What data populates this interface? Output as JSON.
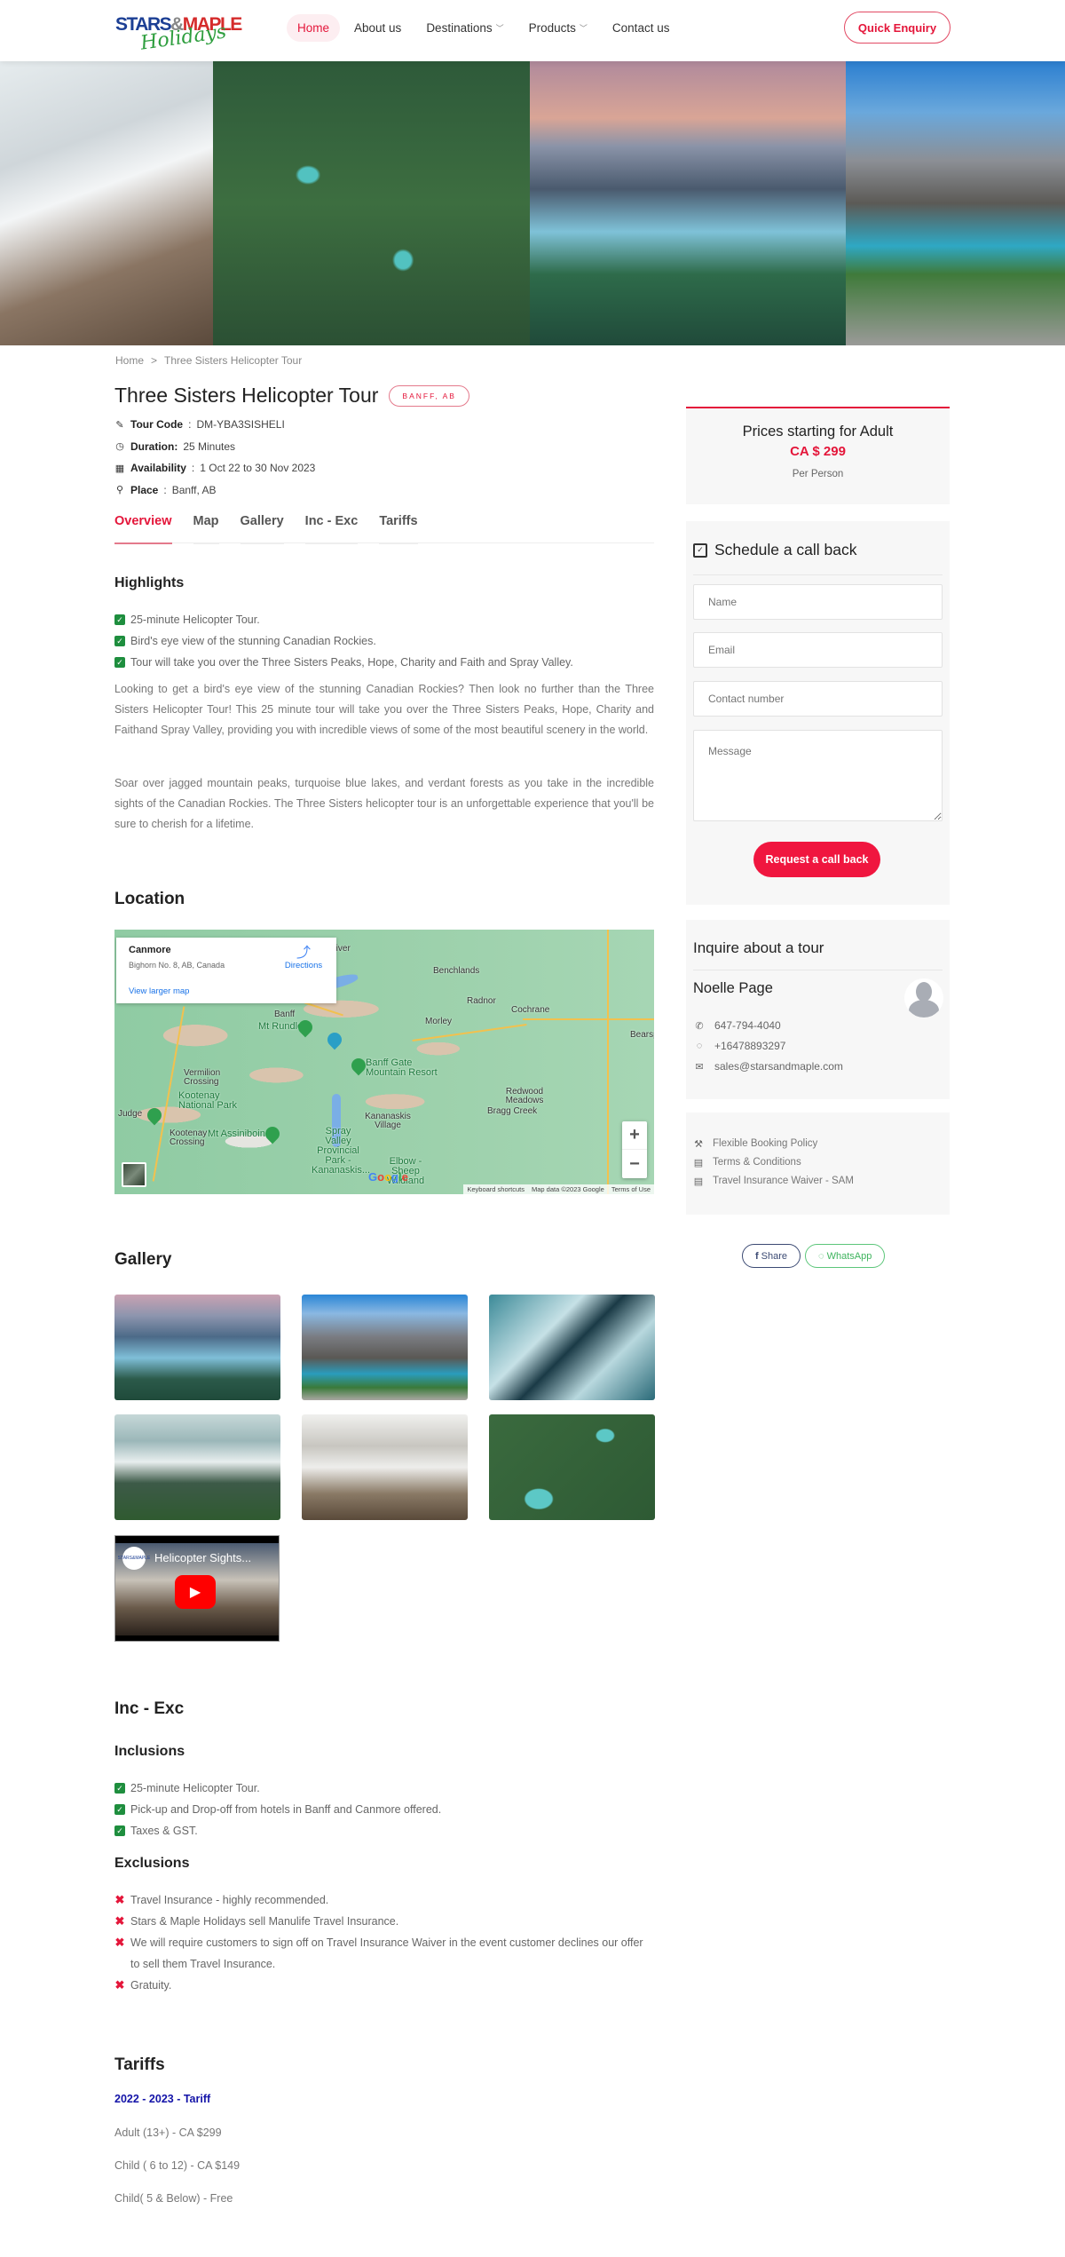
{
  "header": {
    "logo": {
      "line1_a": "STARS",
      "line1_amp": "&",
      "line1_b": "MAPLE",
      "line2": "Holidays"
    },
    "nav": [
      {
        "label": "Home",
        "active": true,
        "dropdown": false
      },
      {
        "label": "About us",
        "active": false,
        "dropdown": false
      },
      {
        "label": "Destinations",
        "active": false,
        "dropdown": true
      },
      {
        "label": "Products",
        "active": false,
        "dropdown": true
      },
      {
        "label": "Contact us",
        "active": false,
        "dropdown": false
      }
    ],
    "quick_enquiry": "Quick Enquiry"
  },
  "hero": {
    "images": [
      "helicopter-over-snowy-peaks",
      "aerial-river-forest",
      "mountain-lake-sunset",
      "mountain-lake-peaks"
    ]
  },
  "breadcrumb": {
    "home": "Home",
    "sep": ">",
    "current": "Three Sisters Helicopter Tour"
  },
  "tour": {
    "title": "Three Sisters Helicopter Tour",
    "badge": "BANFF, AB",
    "meta": [
      {
        "icon": "ticket-icon",
        "label": "Tour Code",
        "sep": ":",
        "value": " DM-YBA3SISHELI"
      },
      {
        "icon": "clock-icon",
        "label": "Duration:",
        "sep": "",
        "value": " 25 Minutes"
      },
      {
        "icon": "calendar-icon",
        "label": "Availability",
        "sep": ":",
        "value": " 1 Oct 22 to 30 Nov 2023"
      },
      {
        "icon": "location-pin-icon",
        "label": "Place",
        "sep": ":",
        "value": " Banff, AB"
      }
    ]
  },
  "tabs": [
    {
      "label": "Overview",
      "active": true
    },
    {
      "label": "Map",
      "active": false
    },
    {
      "label": "Gallery",
      "active": false
    },
    {
      "label": "Inc - Exc",
      "active": false
    },
    {
      "label": "Tariffs",
      "active": false
    }
  ],
  "highlights": {
    "title": "Highlights",
    "items": [
      "25-minute Helicopter Tour.",
      "Bird's eye view of the stunning Canadian Rockies.",
      "Tour will take you over the Three Sisters Peaks, Hope, Charity and Faith and Spray Valley."
    ],
    "paragraphs": [
      "Looking to get a bird's eye view of the stunning Canadian Rockies? Then look no further than the Three Sisters Helicopter Tour! This 25 minute tour will take you over the Three Sisters Peaks, Hope, Charity and Faithand Spray Valley, providing you with incredible views of some of the most beautiful scenery in the world.",
      "Soar over jagged mountain peaks, turquoise blue lakes, and verdant forests as you take in the incredible sights of the Canadian Rockies. The Three Sisters helicopter tour is an unforgettable experience that you'll be sure to cherish for a lifetime."
    ]
  },
  "location": {
    "title": "Location",
    "map": {
      "place_name": "Canmore",
      "place_address": "Bighorn No. 8, AB, Canada",
      "directions": "Directions",
      "view_larger": "View larger map",
      "labels": [
        "Ghost River",
        "Benchlands",
        "Radnor",
        "Cochrane",
        "Morley",
        "Banff",
        "Mt Rundle",
        "Banff Gate Mountain Resort",
        "Vermilion Crossing",
        "Kootenay National Park",
        "Judge",
        "Kootenay Crossing",
        "Mt Assiniboine",
        "Spray Valley Provincial Park - Kananaskis...",
        "Kananaskis Village",
        "Elbow - Sheep Wildland",
        "Redwood Meadows",
        "Bragg Creek",
        "Bearsp"
      ],
      "zoom_in": "+",
      "zoom_out": "−",
      "google": "Google",
      "attribution": [
        "Keyboard shortcuts",
        "Map data ©2023 Google",
        "Terms of Use"
      ]
    }
  },
  "gallery": {
    "title": "Gallery",
    "images": [
      "mountain-lake-sunset",
      "mount-assiniboine-lake",
      "aerial-winter-town-river",
      "three-sisters-peaks",
      "helicopter-on-snow-ridge",
      "aerial-river-forest"
    ],
    "video": {
      "title": "Helicopter Sights...",
      "channel": "STARS&MAPLE"
    }
  },
  "inc_exc": {
    "title": "Inc - Exc",
    "inclusions_title": "Inclusions",
    "inclusions": [
      "25-minute Helicopter Tour.",
      "Pick-up and Drop-off from hotels in Banff and Canmore offered.",
      "Taxes & GST."
    ],
    "exclusions_title": "Exclusions",
    "exclusions": [
      "Travel Insurance - highly recommended.",
      "Stars & Maple Holidays sell Manulife Travel Insurance.",
      "We will require customers to sign off on Travel Insurance Waiver in the event customer declines our offer to sell them Travel Insurance.",
      "Gratuity."
    ]
  },
  "tariffs": {
    "title": "Tariffs",
    "season": "2022 - 2023 -  Tariff",
    "rows": [
      "Adult (13+) - CA $299",
      "Child ( 6 to 12) - CA $149",
      "Child( 5 & Below) - Free"
    ]
  },
  "sidebar": {
    "price": {
      "title": "Prices starting for Adult",
      "value": "CA $ 299",
      "per": "Per Person"
    },
    "callback": {
      "title": "Schedule a call back",
      "name_placeholder": "Name",
      "email_placeholder": "Email",
      "contact_placeholder": "Contact number",
      "message_placeholder": "Message",
      "submit": "Request a call back"
    },
    "inquire": {
      "title": "Inquire about a tour",
      "agent": "Noelle Page",
      "phone": "647-794-4040",
      "whatsapp": "+16478893297",
      "email": "sales@starsandmaple.com"
    },
    "policies": [
      "Flexible Booking Policy",
      "Terms & Conditions",
      "Travel Insurance Waiver - SAM"
    ],
    "share": {
      "facebook": "Share",
      "whatsapp": "WhatsApp"
    }
  },
  "colors": {
    "accent": "#e4163a",
    "button": "#f0163f",
    "check": "#1e8e3e",
    "tariff_head": "#1414a8",
    "panel_bg": "#f7f7f7"
  }
}
